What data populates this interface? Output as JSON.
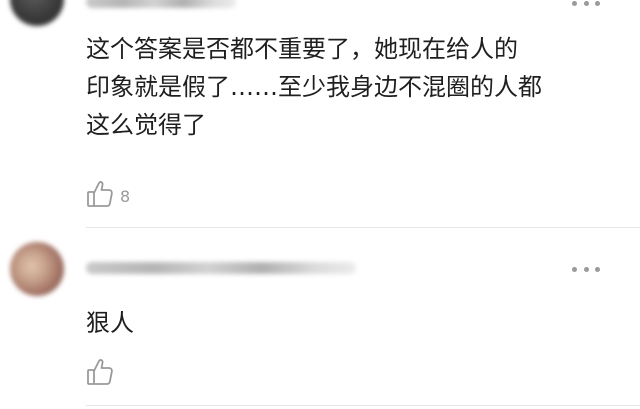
{
  "comments": [
    {
      "text": "这个答案是否都不重要了，她现在给人的\n印象就是假了……至少我身边不混圈的人都\n这么觉得了",
      "likes": "8",
      "avatar_colors": [
        "#3a3a3a",
        "#5c5c5c"
      ],
      "icons": {
        "more": "more-dots-icon",
        "like": "thumbs-up-icon"
      }
    },
    {
      "text": "狠人",
      "likes": "",
      "avatar_colors": [
        "#c9a48d",
        "#8a5f4b"
      ],
      "icons": {
        "more": "more-dots-icon",
        "like": "thumbs-up-icon"
      }
    }
  ],
  "colors": {
    "text": "#1f1f1f",
    "muted": "#9a9a9a",
    "divider": "#e6e6e6"
  }
}
